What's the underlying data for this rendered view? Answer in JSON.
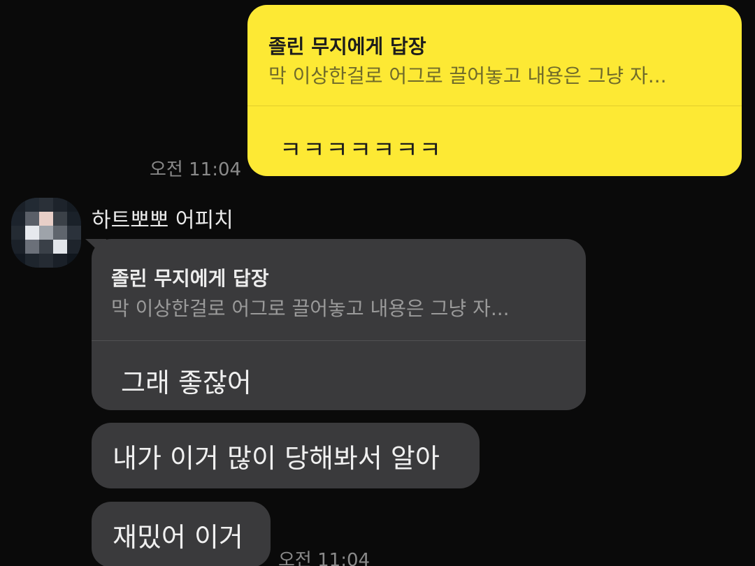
{
  "outgoing": {
    "reply_header": "졸린 무지에게 답장",
    "reply_quote": "막 이상한걸로 어그로 끌어놓고 내용은 그냥 자...",
    "message": "ㅋㅋㅋㅋㅋㅋㅋ",
    "time": "오전 11:04",
    "bubble_color": "#fde934"
  },
  "incoming": {
    "sender_name": "하트뽀뽀 어피치",
    "bubble_color": "#3a3a3c",
    "reply": {
      "reply_header": "졸린 무지에게 답장",
      "reply_quote": "막 이상한걸로 어그로 끌어놓고 내용은 그냥 자...",
      "message": "그래 좋잖어"
    },
    "messages": [
      {
        "text": "내가 이거 많이 당해봐서 알아"
      },
      {
        "text": "재밌어 이거"
      }
    ],
    "time": "오전 11:04"
  },
  "theme": {
    "background": "#0a0a0a",
    "time_color": "#8a8a8a"
  }
}
